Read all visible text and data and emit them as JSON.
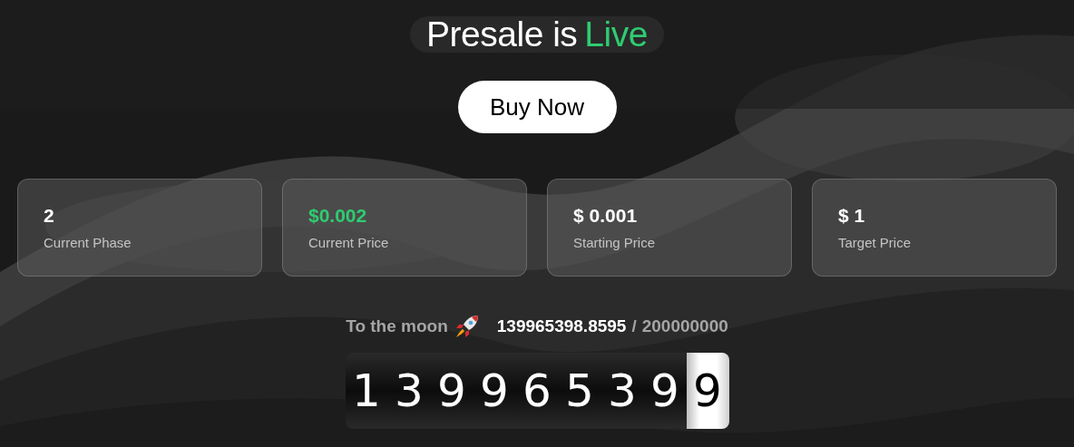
{
  "heading": {
    "text": "Presale is",
    "highlight": "Live"
  },
  "buy_button": "Buy Now",
  "stats": [
    {
      "value": "2",
      "label": "Current Phase",
      "color": "#ffffff"
    },
    {
      "value": "$0.002",
      "label": "Current Price",
      "color": "#2ecc71"
    },
    {
      "value": "$ 0.001",
      "label": "Starting Price",
      "color": "#ffffff"
    },
    {
      "value": "$ 1",
      "label": "Target Price",
      "color": "#ffffff"
    }
  ],
  "progress": {
    "label": "To the moon",
    "sold": "139965398.8595",
    "separator": "/",
    "total": "200000000"
  },
  "counter": [
    {
      "digit": "1",
      "active": false
    },
    {
      "digit": "3",
      "active": false
    },
    {
      "digit": "9",
      "active": false
    },
    {
      "digit": "9",
      "active": false
    },
    {
      "digit": "6",
      "active": false
    },
    {
      "digit": "5",
      "active": false
    },
    {
      "digit": "3",
      "active": false
    },
    {
      "digit": "9",
      "active": false
    },
    {
      "digit": "9",
      "active": true
    }
  ]
}
